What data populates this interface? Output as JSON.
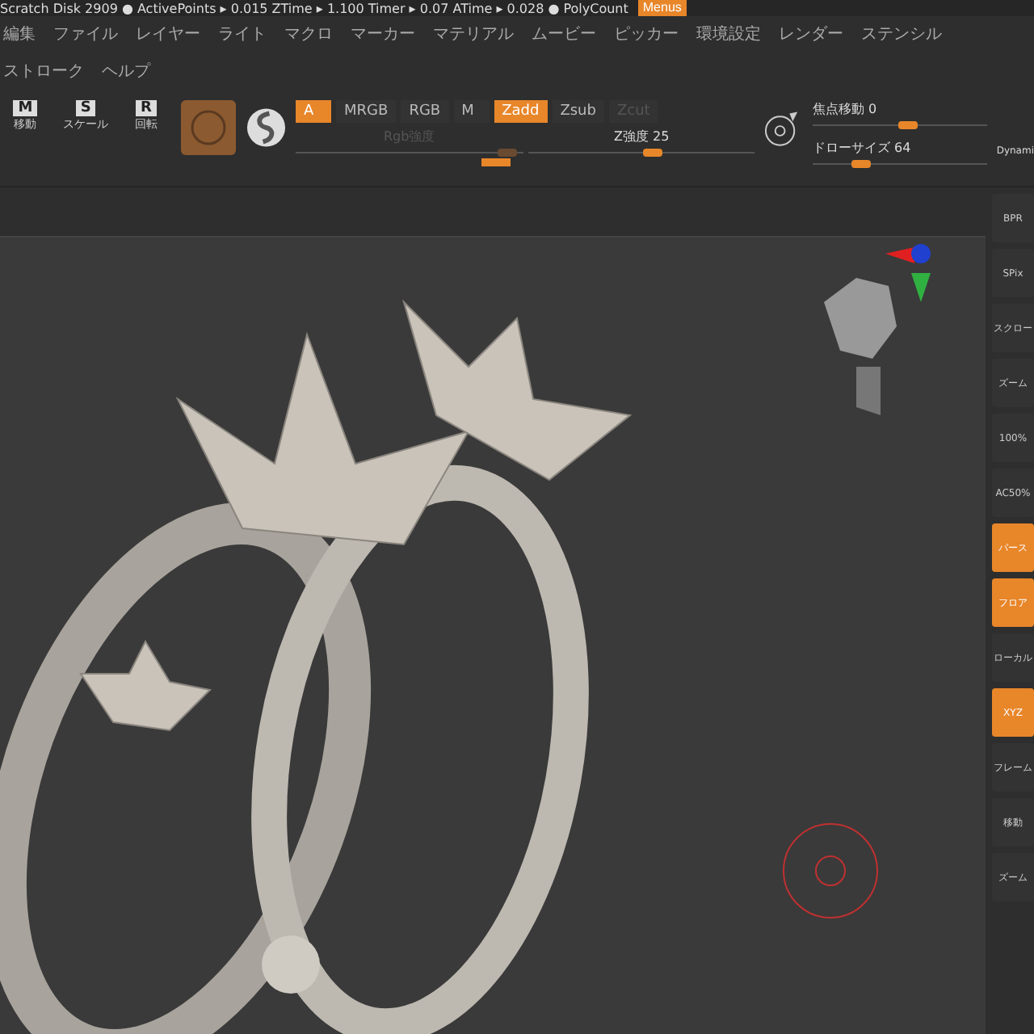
{
  "top_bar": {
    "status": "Scratch Disk 2909 ● ActivePoints ▸ 0.015 ZTime ▸ 1.100 Timer ▸ 0.07 ATime ▸ 0.028 ● PolyCount",
    "menus_button": {
      "label": "Menus",
      "selected": true
    }
  },
  "menu": [
    "編集",
    "ファイル",
    "レイヤー",
    "ライト",
    "マクロ",
    "マーカー",
    "マテリアル",
    "ムービー",
    "ピッカー",
    "環境設定",
    "レンダー",
    "ステンシル",
    "ストローク",
    "ヘルプ"
  ],
  "tools": [
    {
      "key": "M",
      "label": "移動"
    },
    {
      "key": "S",
      "label": "スケール"
    },
    {
      "key": "R",
      "label": "回転"
    }
  ],
  "color_modes": [
    {
      "label": "A",
      "selected": true
    },
    {
      "label": "MRGB",
      "selected": false
    },
    {
      "label": "RGB",
      "selected": false
    },
    {
      "label": "M",
      "selected": false
    }
  ],
  "z_modes": [
    {
      "label": "Zadd",
      "selected": true,
      "disabled": false
    },
    {
      "label": "Zsub",
      "selected": false,
      "disabled": false
    },
    {
      "label": "Zcut",
      "selected": false,
      "disabled": true
    }
  ],
  "sliders": [
    {
      "label": "Rgb強度",
      "disabled": true,
      "level": 0.93
    },
    {
      "label": "Z強度 25",
      "disabled": false,
      "level": 0.55
    }
  ],
  "right_sliders": [
    {
      "label": "焦点移動 0",
      "level": 0.55
    },
    {
      "label": "ドローサイズ 64",
      "level": 0.28
    }
  ],
  "dynamic_label": "Dynami",
  "shelf": [
    {
      "label": "BPR",
      "active": false
    },
    {
      "label": "SPix",
      "active": false
    },
    {
      "label": "スクロー",
      "active": false
    },
    {
      "label": "ズーム",
      "active": false
    },
    {
      "label": "100%",
      "active": false
    },
    {
      "label": "AC50%",
      "active": false
    },
    {
      "label": "パース",
      "active": true
    },
    {
      "label": "フロア",
      "active": true
    },
    {
      "label": "ローカル",
      "active": false
    },
    {
      "label": "XYZ",
      "active": true
    },
    {
      "label": "フレーム",
      "active": false
    },
    {
      "label": "移動",
      "active": false
    },
    {
      "label": "ズーム",
      "active": false
    }
  ]
}
